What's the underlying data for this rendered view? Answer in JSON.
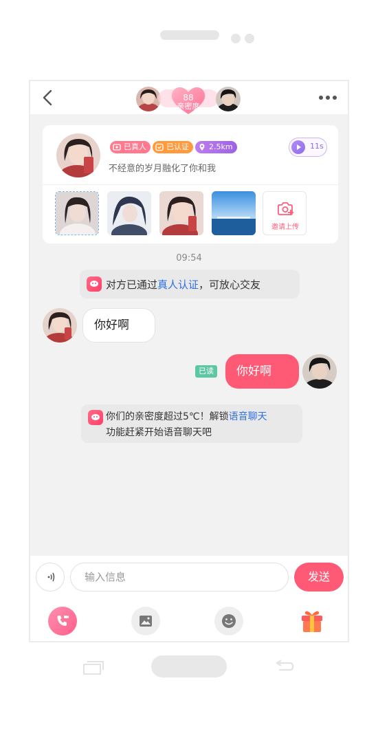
{
  "header": {
    "intimacy_value": "88",
    "intimacy_label": "亲密度"
  },
  "profile": {
    "badges": {
      "real_person": "已真人",
      "certified": "已认证",
      "distance": "2.5km"
    },
    "voice_duration": "11s",
    "bio": "不经意的岁月融化了你和我",
    "upload_label": "邀请上传"
  },
  "chat": {
    "time": "09:54",
    "system_msg_1": {
      "before": "对方已通过",
      "link": "真人认证",
      "after": "，可放心交友"
    },
    "incoming_text": "你好啊",
    "outgoing_text": "你好啊",
    "read_status": "已读",
    "system_msg_2": {
      "before": "你们的亲密度超过5℃！解锁",
      "link": "语音聊天",
      "line2": "功能赶紧开始语音聊天吧"
    }
  },
  "composer": {
    "placeholder": "输入信息",
    "send_label": "发送"
  },
  "colors": {
    "accent": "#ff5a75",
    "link": "#2f6fe0",
    "read_badge": "#5dc7a3",
    "voice_purple": "#8f6de8"
  },
  "icons": [
    "back-icon",
    "more-icon",
    "voice-play-icon",
    "camera-plus-icon",
    "voice-input-icon",
    "video-call-icon",
    "image-icon",
    "emoji-icon",
    "gift-icon"
  ]
}
